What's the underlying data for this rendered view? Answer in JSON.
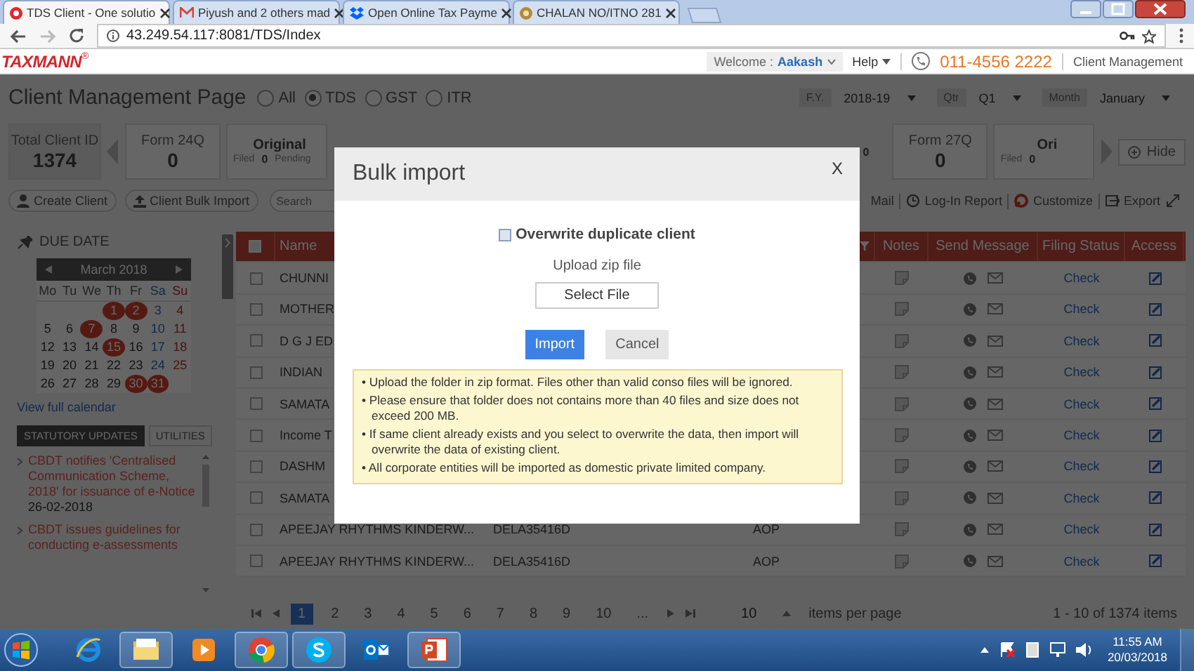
{
  "browser": {
    "tabs": [
      {
        "title": "TDS Client - One solutio",
        "kind": "record",
        "selected": true
      },
      {
        "title": "Piyush and 2 others mad",
        "kind": "mail",
        "selected": false
      },
      {
        "title": "Open Online Tax Payme",
        "kind": "box",
        "selected": false
      },
      {
        "title": "CHALAN NO/ITNO 281",
        "kind": "emblem",
        "selected": false
      }
    ],
    "address": "43.249.54.117:8081/TDS/Index"
  },
  "header": {
    "logo": "TAXMANN",
    "logo_mark": "®",
    "welcome_label": "Welcome :",
    "user": "Aakash",
    "help": "Help",
    "phone": "011-4556 2222",
    "link": "Client Management"
  },
  "page": {
    "title": "Client Management Page",
    "scopes": [
      {
        "label": "All",
        "selected": false
      },
      {
        "label": "TDS",
        "selected": true
      },
      {
        "label": "GST",
        "selected": false
      },
      {
        "label": "ITR",
        "selected": false
      }
    ],
    "filters": [
      {
        "label": "F.Y.",
        "value": "2018-19"
      },
      {
        "label": "Qtr",
        "value": "Q1"
      },
      {
        "label": "Month",
        "value": "January"
      }
    ]
  },
  "stats": {
    "left": [
      {
        "kind": "total",
        "label": "Total Client ID",
        "value": "1374"
      },
      {
        "kind": "arrow"
      },
      {
        "kind": "form",
        "label": "Form 24Q",
        "value": "0"
      },
      {
        "kind": "partial",
        "label": "Original",
        "filed_label": "Filed",
        "filed": "0",
        "pending_label": "Pending"
      }
    ],
    "right": [
      {
        "kind": "value",
        "value": "0"
      },
      {
        "kind": "form",
        "label": "Form 27Q",
        "value": "0"
      },
      {
        "kind": "partial",
        "label": "Ori",
        "filed_label": "Filed",
        "filed": "0"
      },
      {
        "kind": "arrow"
      }
    ],
    "hide": "Hide"
  },
  "toolbar": {
    "create": "Create Client",
    "bulk": "Client Bulk Import",
    "search_placeholder": "Search",
    "actions": [
      {
        "kind": "mail",
        "label": "Mail"
      },
      {
        "kind": "report",
        "label": "Log-In Report"
      },
      {
        "kind": "customize",
        "label": "Customize"
      },
      {
        "kind": "export",
        "label": "Export"
      }
    ]
  },
  "sidebar": {
    "title": "DUE DATE",
    "calendar": {
      "month": "March 2018",
      "weekdays": [
        "Mo",
        "Tu",
        "We",
        "Th",
        "Fr",
        "Sa",
        "Su"
      ],
      "weeks": [
        [
          {
            "day": "1",
            "highlighted": true
          },
          {
            "day": "2",
            "highlighted": true
          },
          {
            "day": "3",
            "highlighted": false
          },
          {
            "day": "4",
            "highlighted": false
          }
        ],
        [
          {
            "day": "5",
            "highlighted": false
          },
          {
            "day": "6",
            "highlighted": false
          },
          {
            "day": "7",
            "highlighted": true
          },
          {
            "day": "8",
            "highlighted": false
          },
          {
            "day": "9",
            "highlighted": false
          },
          {
            "day": "10",
            "highlighted": false
          },
          {
            "day": "11",
            "highlighted": false
          }
        ],
        [
          {
            "day": "12",
            "highlighted": false
          },
          {
            "day": "13",
            "highlighted": false
          },
          {
            "day": "14",
            "highlighted": false
          },
          {
            "day": "15",
            "highlighted": true
          },
          {
            "day": "16",
            "highlighted": false
          },
          {
            "day": "17",
            "highlighted": false
          },
          {
            "day": "18",
            "highlighted": false
          }
        ],
        [
          {
            "day": "19",
            "highlighted": false
          },
          {
            "day": "20",
            "highlighted": false
          },
          {
            "day": "21",
            "highlighted": false
          },
          {
            "day": "22",
            "highlighted": false
          },
          {
            "day": "23",
            "highlighted": false
          },
          {
            "day": "24",
            "highlighted": false
          },
          {
            "day": "25",
            "highlighted": false
          }
        ],
        [
          {
            "day": "26",
            "highlighted": false
          },
          {
            "day": "27",
            "highlighted": false
          },
          {
            "day": "28",
            "highlighted": false
          },
          {
            "day": "29",
            "highlighted": false
          },
          {
            "day": "30",
            "highlighted": true
          },
          {
            "day": "31",
            "highlighted": true
          }
        ]
      ]
    },
    "view_all": "View full calendar",
    "update_tabs": [
      {
        "label": "STATUTORY UPDATES",
        "selected": true
      },
      {
        "label": "UTILITIES",
        "selected": false
      }
    ],
    "news": [
      {
        "text": "CBDT notifies 'Centralised Communication Scheme, 2018' for issuance of e-Notice",
        "date": "26-02-2018"
      },
      {
        "text": "CBDT issues guidelines for conducting e-assessments"
      }
    ]
  },
  "table": {
    "columns": [
      "Name",
      "Notes",
      "Send Message",
      "Filing Status",
      "Access"
    ],
    "all_checked": false,
    "rows": [
      {
        "checked": false,
        "name": "CHUNNI",
        "filing_status": "Check"
      },
      {
        "checked": false,
        "name": "MOTHER",
        "filing_status": "Check"
      },
      {
        "checked": false,
        "name": "D G J ED",
        "filing_status": "Check"
      },
      {
        "checked": false,
        "name": "INDIAN",
        "filing_status": "Check"
      },
      {
        "checked": false,
        "name": "SAMATA",
        "filing_status": "Check"
      },
      {
        "checked": false,
        "name": "Income T",
        "filing_status": "Check"
      },
      {
        "checked": false,
        "name": "DASHM",
        "filing_status": "Check"
      },
      {
        "checked": false,
        "name": "SAMATA",
        "filing_status": "Check"
      },
      {
        "checked": false,
        "name": "APEEJAY RHYTHMS KINDERW...",
        "column_3": "DELA35416D",
        "column_4": "AOP",
        "filing_status": "Check"
      },
      {
        "checked": false,
        "name": "APEEJAY RHYTHMS KINDERW...",
        "column_3": "DELA35416D",
        "column_4": "AOP",
        "filing_status": "Check"
      }
    ]
  },
  "pagination": {
    "pages": [
      {
        "label": "1",
        "selected": true
      },
      {
        "label": "2",
        "selected": false
      },
      {
        "label": "3",
        "selected": false
      },
      {
        "label": "4",
        "selected": false
      },
      {
        "label": "5",
        "selected": false
      },
      {
        "label": "6",
        "selected": false
      },
      {
        "label": "7",
        "selected": false
      },
      {
        "label": "8",
        "selected": false
      },
      {
        "label": "9",
        "selected": false
      },
      {
        "label": "10",
        "selected": false
      }
    ],
    "more": "...",
    "page_size": "10",
    "page_size_label": "items per page",
    "summary": "1 - 10 of 1374 items"
  },
  "modal": {
    "title": "Bulk import",
    "close": "X",
    "overwrite": {
      "label": "Overwrite duplicate client",
      "checked": false
    },
    "upload_label": "Upload zip file",
    "select_button": "Select File",
    "import_button": "Import",
    "cancel_button": "Cancel",
    "notes": [
      "• Upload the folder in zip format. Files other than valid conso files will be ignored.",
      "• Please ensure that folder does not contains more than 40 files and size does not exceed 200 MB.",
      "• If same client already exists and you select to overwrite the data, then import will overwrite the data of existing client.",
      "• All corporate entities will be imported as domestic private limited company."
    ]
  },
  "taskbar": {
    "apps": [
      {
        "kind": "ie",
        "running": false
      },
      {
        "kind": "folder",
        "running": true
      },
      {
        "kind": "media",
        "running": false
      },
      {
        "kind": "chrome",
        "running": true
      },
      {
        "kind": "skype",
        "running": true
      },
      {
        "kind": "outlook",
        "running": false
      },
      {
        "kind": "powerpoint",
        "running": true
      }
    ],
    "time": "11:55 AM",
    "date": "20/03/2018"
  }
}
